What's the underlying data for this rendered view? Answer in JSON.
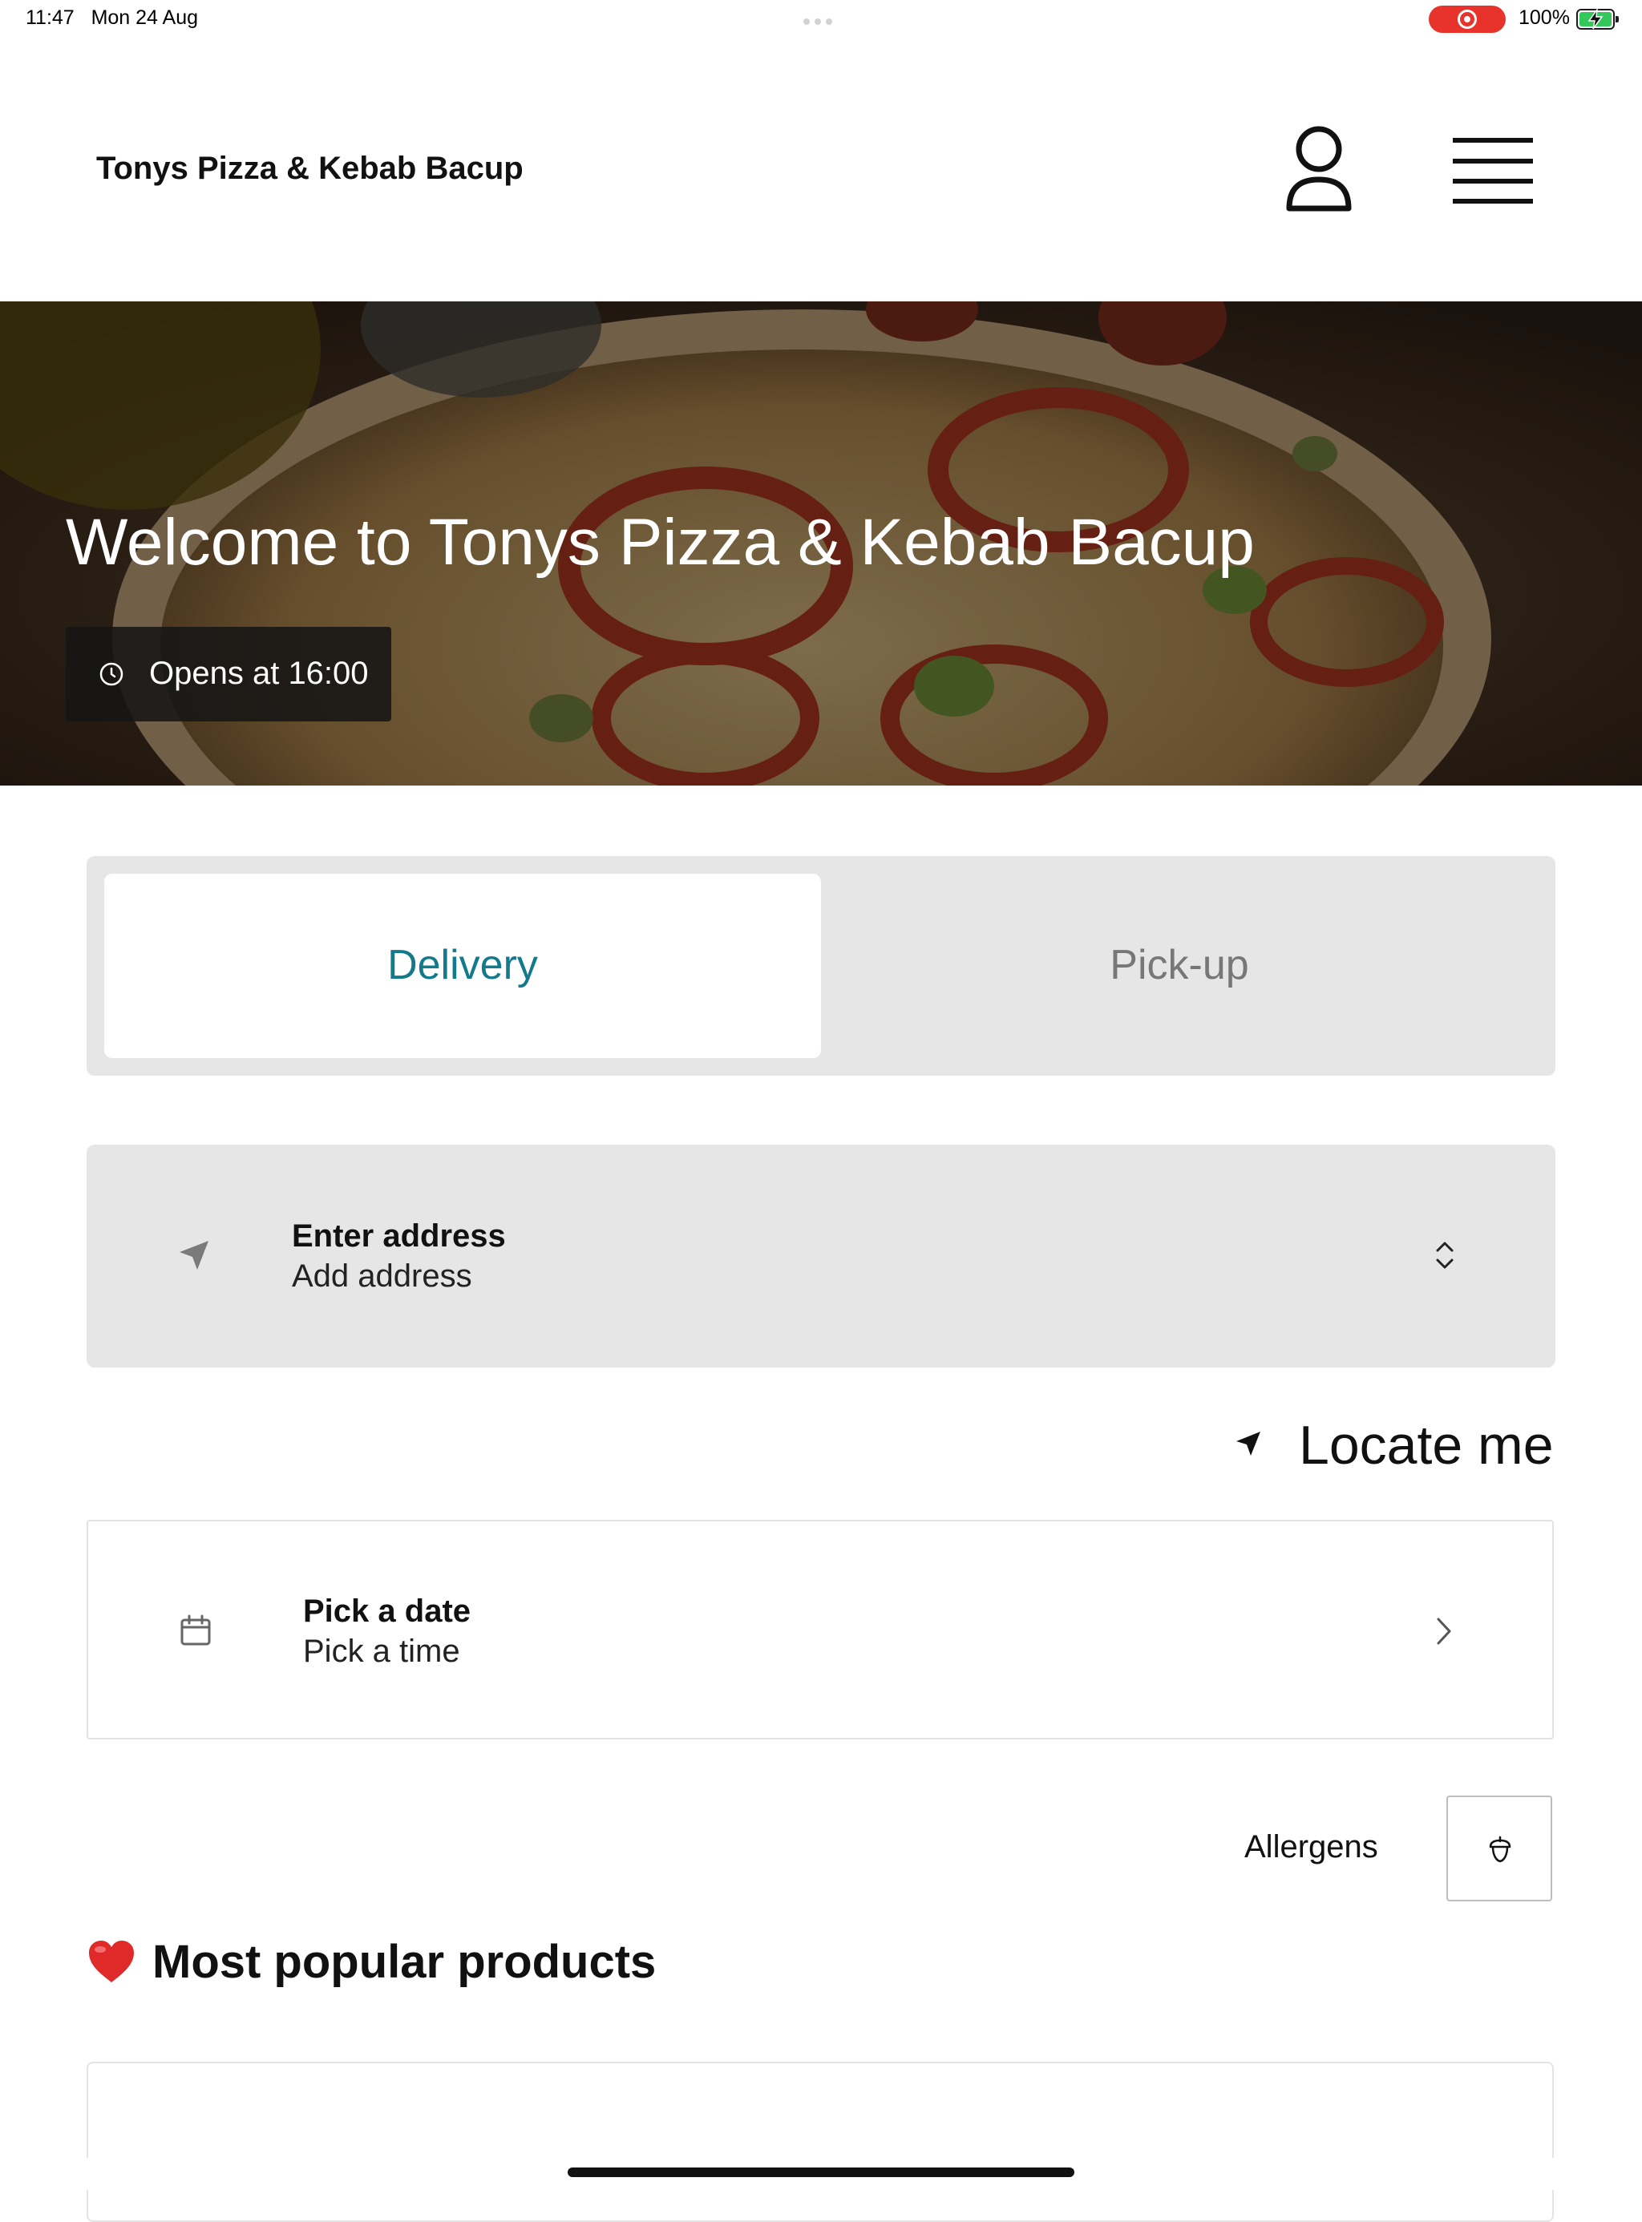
{
  "status_bar": {
    "time": "11:47",
    "date": "Mon 24 Aug",
    "battery_percent": "100%",
    "battery_level": 1.0,
    "recording_indicator_color": "#e8332c",
    "battery_color": "#34c759"
  },
  "header": {
    "brand": "Tonys Pizza & Kebab Bacup",
    "account_icon": "user-icon",
    "menu_icon": "hamburger-menu-icon"
  },
  "hero": {
    "title": "Welcome to Tonys Pizza & Kebab Bacup",
    "opens_label": "Opens at 16:00",
    "clock_icon": "clock-icon"
  },
  "order_mode": {
    "tabs": [
      {
        "label": "Delivery",
        "selected": true
      },
      {
        "label": "Pick-up",
        "selected": false
      }
    ],
    "accent_color": "#127a8b"
  },
  "address": {
    "title": "Enter address",
    "subtitle": "Add address",
    "icon": "navigation-arrow-icon",
    "expand_icon": "chevron-up-down-icon"
  },
  "locate": {
    "label": "Locate me",
    "icon": "location-arrow-icon"
  },
  "schedule": {
    "title": "Pick a date",
    "subtitle": "Pick a time",
    "icon": "calendar-icon",
    "chevron_icon": "chevron-right-icon"
  },
  "allergens": {
    "label": "Allergens",
    "icon": "acorn-icon"
  },
  "popular": {
    "emoji": "❤️",
    "title": "Most popular products"
  }
}
